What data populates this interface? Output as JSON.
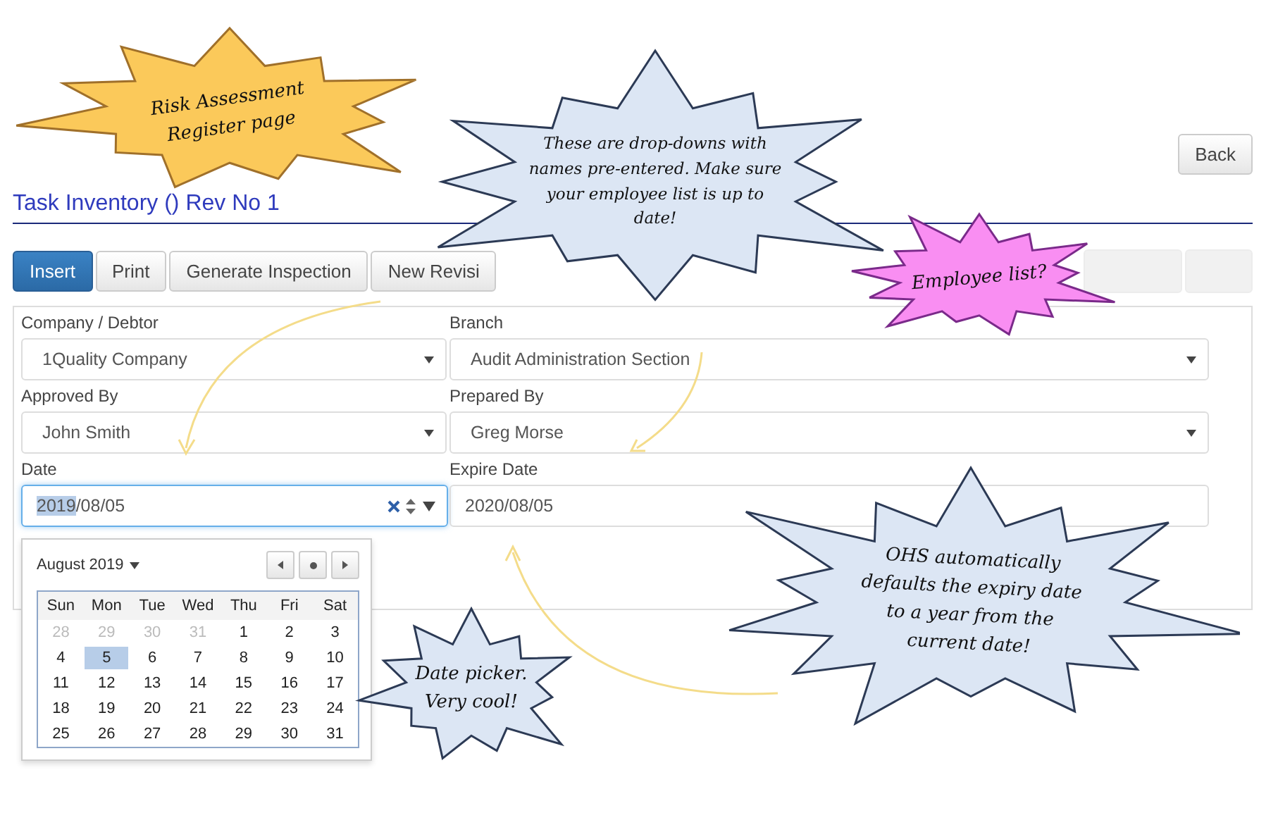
{
  "back_button": "Back",
  "title": "Task Inventory () Rev No 1",
  "toolbar": [
    {
      "label": "Insert",
      "primary": true
    },
    {
      "label": "Print",
      "primary": false
    },
    {
      "label": "Generate Inspection",
      "primary": false
    },
    {
      "label": "New Revisi",
      "primary": false
    }
  ],
  "form": {
    "fields": [
      {
        "kind": "select",
        "label": "Company / Debtor",
        "value": "1Quality Company"
      },
      {
        "kind": "select",
        "label": "Branch",
        "value": "Audit Administration Section"
      },
      {
        "kind": "select",
        "label": "Approved By",
        "value": "John Smith"
      },
      {
        "kind": "select",
        "label": "Prepared By",
        "value": "Greg Morse"
      },
      {
        "kind": "date",
        "label": "Date",
        "value_selected": "2019",
        "value_rest": "/08/05",
        "focused": true
      },
      {
        "kind": "text",
        "label": "Expire Date",
        "value": "2020/08/05",
        "focused": false
      }
    ]
  },
  "calendar": {
    "month_label": "August 2019",
    "weekdays": [
      "Sun",
      "Mon",
      "Tue",
      "Wed",
      "Thu",
      "Fri",
      "Sat"
    ],
    "weeks": [
      [
        {
          "day": "28",
          "outside": true,
          "selected": false
        },
        {
          "day": "29",
          "outside": true,
          "selected": false
        },
        {
          "day": "30",
          "outside": true,
          "selected": false
        },
        {
          "day": "31",
          "outside": true,
          "selected": false
        },
        {
          "day": "1",
          "outside": false,
          "selected": false
        },
        {
          "day": "2",
          "outside": false,
          "selected": false
        },
        {
          "day": "3",
          "outside": false,
          "selected": false
        }
      ],
      [
        {
          "day": "4",
          "outside": false,
          "selected": false
        },
        {
          "day": "5",
          "outside": false,
          "selected": true
        },
        {
          "day": "6",
          "outside": false,
          "selected": false
        },
        {
          "day": "7",
          "outside": false,
          "selected": false
        },
        {
          "day": "8",
          "outside": false,
          "selected": false
        },
        {
          "day": "9",
          "outside": false,
          "selected": false
        },
        {
          "day": "10",
          "outside": false,
          "selected": false
        }
      ],
      [
        {
          "day": "11",
          "outside": false,
          "selected": false
        },
        {
          "day": "12",
          "outside": false,
          "selected": false
        },
        {
          "day": "13",
          "outside": false,
          "selected": false
        },
        {
          "day": "14",
          "outside": false,
          "selected": false
        },
        {
          "day": "15",
          "outside": false,
          "selected": false
        },
        {
          "day": "16",
          "outside": false,
          "selected": false
        },
        {
          "day": "17",
          "outside": false,
          "selected": false
        }
      ],
      [
        {
          "day": "18",
          "outside": false,
          "selected": false
        },
        {
          "day": "19",
          "outside": false,
          "selected": false
        },
        {
          "day": "20",
          "outside": false,
          "selected": false
        },
        {
          "day": "21",
          "outside": false,
          "selected": false
        },
        {
          "day": "22",
          "outside": false,
          "selected": false
        },
        {
          "day": "23",
          "outside": false,
          "selected": false
        },
        {
          "day": "24",
          "outside": false,
          "selected": false
        }
      ],
      [
        {
          "day": "25",
          "outside": false,
          "selected": false
        },
        {
          "day": "26",
          "outside": false,
          "selected": false
        },
        {
          "day": "27",
          "outside": false,
          "selected": false
        },
        {
          "day": "28",
          "outside": false,
          "selected": false
        },
        {
          "day": "29",
          "outside": false,
          "selected": false
        },
        {
          "day": "30",
          "outside": false,
          "selected": false
        },
        {
          "day": "31",
          "outside": false,
          "selected": false
        }
      ]
    ]
  },
  "callouts": [
    {
      "lines": [
        "Risk Assessment",
        "Register page"
      ],
      "color": "#fbc95a"
    },
    {
      "lines": [
        "These are drop-downs with",
        "names pre-entered. Make sure",
        "your employee list is up to",
        "date!"
      ],
      "color": "#dce6f4"
    },
    {
      "lines": [
        "Employee list?"
      ],
      "color": "#f98ef2"
    },
    {
      "lines": [
        "OHS automatically",
        "defaults the expiry date",
        "to a year from the",
        "current date!"
      ],
      "color": "#dce6f4"
    },
    {
      "lines": [
        "Date picker.",
        "Very cool!"
      ],
      "color": "#dce6f4"
    }
  ]
}
